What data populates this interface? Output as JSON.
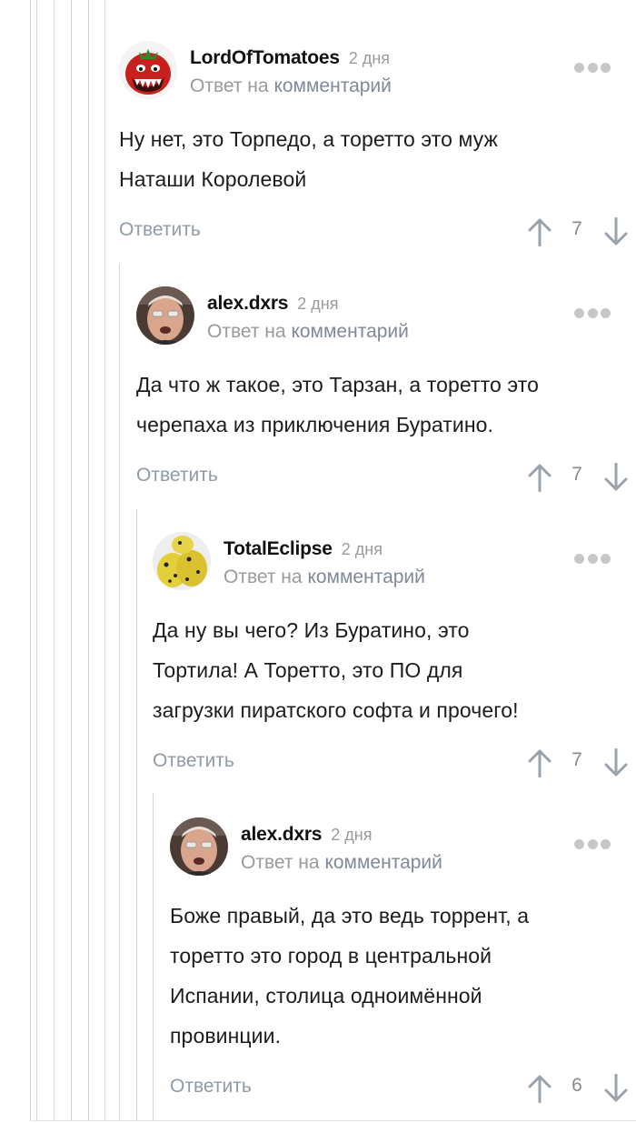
{
  "comments": [
    {
      "author": "LordOfTomatoes",
      "time": "2 дня",
      "reply_prefix": "Ответ на",
      "reply_link": "комментарий",
      "text": "Ну нет, это Торпедо, а торетто это муж\nНаташи Королевой",
      "reply_button": "Ответить",
      "votes": "7",
      "avatar_icon": "tomato-monster-avatar"
    },
    {
      "author": "alex.dxrs",
      "time": "2 дня",
      "reply_prefix": "Ответ на",
      "reply_link": "комментарий",
      "text": "Да что ж такое, это Тарзан, а торетто это\nчерепаха из приключения Буратино.",
      "reply_button": "Ответить",
      "votes": "7",
      "avatar_icon": "face-photo-avatar"
    },
    {
      "author": "TotalEclipse",
      "time": "2 дня",
      "reply_prefix": "Ответ на",
      "reply_link": "комментарий",
      "text": "Да ну вы чего? Из Буратино, это\nТортила! А Торетто, это ПО для\nзагрузки пиратского софта и прочего!",
      "reply_button": "Ответить",
      "votes": "7",
      "avatar_icon": "yellow-figure-avatar"
    },
    {
      "author": "alex.dxrs",
      "time": "2 дня",
      "reply_prefix": "Ответ на",
      "reply_link": "комментарий",
      "text": "Боже правый, да это ведь торрент, а\nторетто это город в центральной\nИспании, столица одноимённой\nпровинции.",
      "reply_button": "Ответить",
      "votes": "6",
      "avatar_icon": "face-photo-avatar"
    }
  ],
  "colors": {
    "guide_line": "#d5d5d5",
    "muted_text": "#9a9a9a",
    "link": "#7f8a96",
    "action": "#8f9ba6"
  }
}
